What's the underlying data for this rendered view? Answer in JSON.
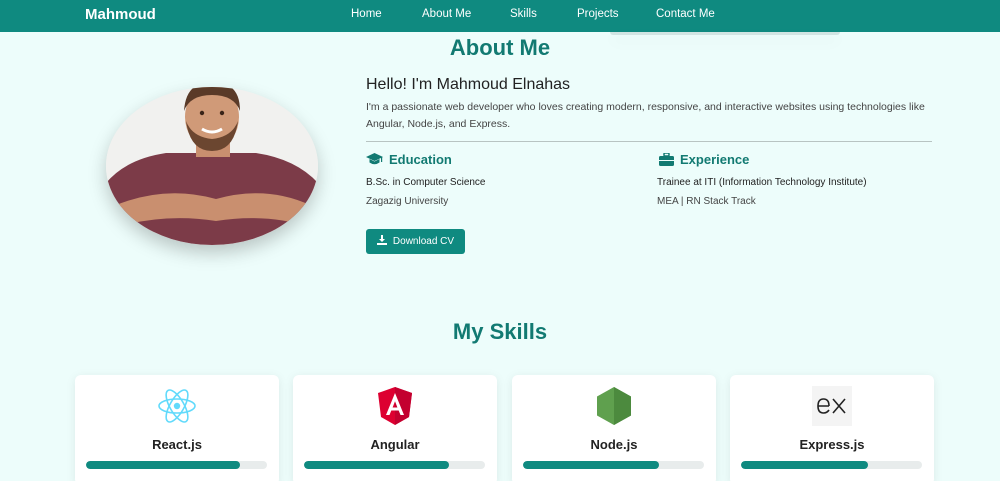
{
  "navbar": {
    "brand": "Mahmoud",
    "links": [
      "Home",
      "About Me",
      "Skills",
      "Projects",
      "Contact Me"
    ]
  },
  "about": {
    "title": "About Me",
    "greeting": "Hello! I'm Mahmoud Elnahas",
    "intro": "I'm a passionate web developer who loves creating modern, responsive, and interactive websites using technologies like Angular, Node.js, and Express.",
    "education": {
      "heading": "Education",
      "icon": "graduation-cap-icon",
      "lines": [
        "B.Sc. in Computer Science",
        "Zagazig University"
      ]
    },
    "experience": {
      "heading": "Experience",
      "icon": "briefcase-icon",
      "lines": [
        "Trainee at ITI (Information Technology Institute)",
        "MEA | RN Stack Track"
      ]
    },
    "download_label": "Download CV"
  },
  "skills": {
    "title": "My Skills",
    "items": [
      {
        "name": "React.js",
        "icon": "react-icon",
        "level": 0.85
      },
      {
        "name": "Angular",
        "icon": "angular-icon",
        "level": 0.8
      },
      {
        "name": "Node.js",
        "icon": "nodejs-icon",
        "level": 0.75
      },
      {
        "name": "Express.js",
        "icon": "express-icon",
        "level": 0.7
      }
    ]
  },
  "colors": {
    "primary": "#0f8a80",
    "heading": "#127a72",
    "background": "#edfdfb",
    "react": "#61dafb",
    "angular": "#dd0031",
    "node": "#5fa04e"
  }
}
